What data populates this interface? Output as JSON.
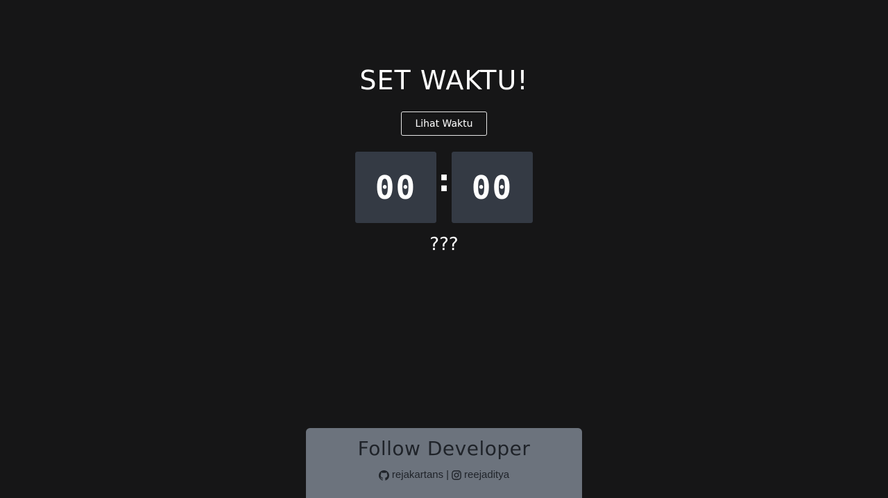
{
  "header": {
    "title": "SET WAKTU!"
  },
  "controls": {
    "view_time_label": "Lihat Waktu"
  },
  "clock": {
    "hours": "00",
    "separator": ":",
    "minutes": "00"
  },
  "status": {
    "text": "???"
  },
  "footer": {
    "title": "Follow Developer",
    "github_handle": "rejakartans",
    "divider": "|",
    "instagram_handle": "reejaditya",
    "github_icon": "github-icon",
    "instagram_icon": "instagram-icon"
  },
  "colors": {
    "background": "#161617",
    "clock_box": "#343a44",
    "footer_bg": "#6c737d",
    "footer_text": "#1f2329"
  }
}
